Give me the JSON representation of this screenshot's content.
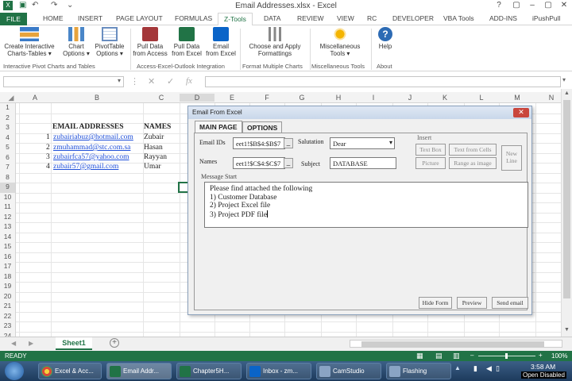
{
  "app": {
    "title": "Email Addresses.xlsx - Excel",
    "window_controls": [
      "?",
      "▢",
      "–",
      "▢",
      "✕"
    ]
  },
  "ribbon_tabs": [
    {
      "label": "FILE",
      "x": 0
    },
    {
      "label": "HOME"
    },
    {
      "label": "INSERT"
    },
    {
      "label": "PAGE LAYOUT"
    },
    {
      "label": "FORMULAS"
    },
    {
      "label": "Z-Tools"
    },
    {
      "label": "DATA"
    },
    {
      "label": "REVIEW"
    },
    {
      "label": "VIEW"
    },
    {
      "label": "RC"
    },
    {
      "label": "DEVELOPER"
    },
    {
      "label": "VBA Tools"
    },
    {
      "label": "ADD-INS"
    },
    {
      "label": "iPushPull"
    }
  ],
  "ribbon": {
    "buttons": [
      {
        "label": "Create Interactive",
        "label2": "Charts-Tables ▾"
      },
      {
        "label": "Chart",
        "label2": "Options ▾"
      },
      {
        "label": "PivotTable",
        "label2": "Options ▾"
      },
      {
        "label": "Pull Data",
        "label2": "from Access"
      },
      {
        "label": "Pull Data",
        "label2": "from Excel"
      },
      {
        "label": "Email",
        "label2": "from Excel"
      },
      {
        "label": "Choose and Apply",
        "label2": "Formattings"
      },
      {
        "label": "Miscellaneous",
        "label2": "Tools ▾"
      },
      {
        "label": "Help",
        "label2": ""
      }
    ],
    "groups": [
      "Interactive Pivot Charts and Tables",
      "Access-Excel-Outlook Integration",
      "Format Multiple Charts",
      "Miscellaneous Tools",
      "About"
    ]
  },
  "columns": [
    "A",
    "B",
    "C",
    "D",
    "E",
    "F",
    "G",
    "H",
    "I",
    "J",
    "K",
    "L",
    "M",
    "N"
  ],
  "rows": [
    "1",
    "2",
    "3",
    "4",
    "5",
    "6",
    "7",
    "8",
    "9",
    "10",
    "11",
    "12",
    "13",
    "14",
    "15",
    "16",
    "17",
    "18",
    "19",
    "20",
    "21",
    "22",
    "23",
    "24"
  ],
  "sheet": {
    "header_email": "EMAIL ADDRESSES",
    "header_names": "NAMES",
    "records": [
      {
        "num": "1",
        "email": "zubairiabuz@hotmail.com",
        "name": "Zubair"
      },
      {
        "num": "2",
        "email": "zmuhammad@stc.com.sa",
        "name": "Hasan"
      },
      {
        "num": "3",
        "email": "zubairfca57@yahoo.com",
        "name": "Rayyan"
      },
      {
        "num": "4",
        "email": "zubair57@gmail.com",
        "name": "Umar"
      }
    ]
  },
  "dialog": {
    "title": "Email From Excel",
    "close": "✕",
    "tab_main": "MAIN PAGE",
    "tab_options": "OPTIONS",
    "email_ids_label": "Email IDs",
    "email_ids_value": "eet1!$B$4:$B$7",
    "names_label": "Names",
    "names_value": "eet1!$C$4:$C$7",
    "salutation_label": "Salutation",
    "salutation_value": "Dear",
    "subject_label": "Subject",
    "subject_value": "DATABASE",
    "insert_label": "Insert",
    "btn_text_box": "Text Box",
    "btn_text_from_cells": "Text from Cells",
    "btn_new_line": "New Line",
    "btn_picture": "Picture",
    "btn_range_as_image": "Range as image",
    "message_label": "Message Start",
    "message_lines": [
      "Please find attached the following",
      "1) Customer Database",
      "2) Project Excel file",
      "3) Project PDF file"
    ],
    "btn_hide_form": "Hide Form",
    "btn_preview": "Preview",
    "btn_send_email": "Send email"
  },
  "sheet_tab": "Sheet1",
  "status": {
    "ready": "READY",
    "zoom": "100%"
  },
  "taskbar": {
    "items": [
      {
        "label": "Excel & Acc..."
      },
      {
        "label": "Email Addr..."
      },
      {
        "label": "Chapter5H..."
      },
      {
        "label": "Inbox - zm..."
      },
      {
        "label": "CamStudio"
      },
      {
        "label": "Flashing"
      }
    ],
    "time": "3:58 AM",
    "tray_text": "Open Disabled"
  },
  "colors": {
    "excel_green": "#217346",
    "link_blue": "#1f4fd8"
  }
}
